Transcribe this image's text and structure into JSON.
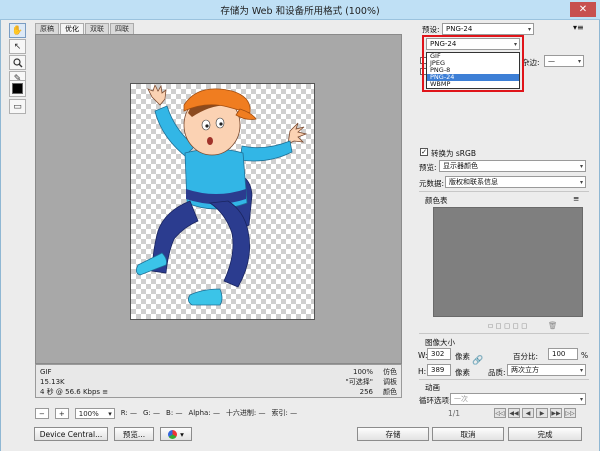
{
  "window": {
    "title": "存储为 Web 和设备所用格式 (100%)",
    "close_glyph": "✕"
  },
  "tools": [
    "hand-icon",
    "slice-select-icon",
    "zoom-icon",
    "eyedropper-icon",
    "color-swatch-icon",
    "toggle-slices-icon"
  ],
  "tools_glyphs": [
    "✋",
    "↖",
    "🔍",
    "✎",
    "■",
    "▭"
  ],
  "tabs": [
    "原稿",
    "优化",
    "双联",
    "四联"
  ],
  "info": {
    "left": [
      "GIF",
      "15.13K",
      "4 秒 @ 56.6 Kbps ≡"
    ],
    "right_values": [
      "100%",
      "\"可选择\"",
      "256"
    ],
    "right_labels": [
      "仿色",
      "调板",
      "颜色"
    ]
  },
  "status": {
    "zoom": "100%",
    "r_label": "R:",
    "r_val": "—",
    "g_label": "G:",
    "g_val": "—",
    "b_label": "B:",
    "b_val": "—",
    "alpha_label": "Alpha:",
    "alpha_val": "—",
    "hex_label": "十六进制:",
    "hex_val": "—",
    "index_label": "索引:",
    "index_val": "—"
  },
  "buttons": {
    "device_central": "Device Central...",
    "preview": "预览...",
    "save": "存储",
    "cancel": "取消",
    "done": "完成"
  },
  "right": {
    "preset_label": "预设:",
    "preset_value": "PNG-24",
    "format_value": "PNG-24",
    "format_options": [
      "GIF",
      "JPEG",
      "PNG-8",
      "PNG-24",
      "WBMP"
    ],
    "format_selected": "PNG-24",
    "matte_label": "杂边:",
    "matte_value": "—",
    "convert_srgb": "转换为 sRGB",
    "preview_label": "预览:",
    "preview_value": "显示器颜色",
    "metadata_label": "元数据:",
    "metadata_value": "版权和联系信息",
    "color_table_label": "颜色表",
    "image_size_label": "图像大小",
    "w_label": "W:",
    "w_value": "302",
    "h_label": "H:",
    "h_value": "389",
    "px_label": "像素",
    "percent_label": "百分比:",
    "percent_value": "100",
    "percent_unit": "%",
    "quality_label": "品质:",
    "quality_value": "两次立方",
    "animation_label": "动画",
    "loop_label": "循环选项:",
    "loop_value": "一次",
    "frame_counter": "1/1"
  }
}
